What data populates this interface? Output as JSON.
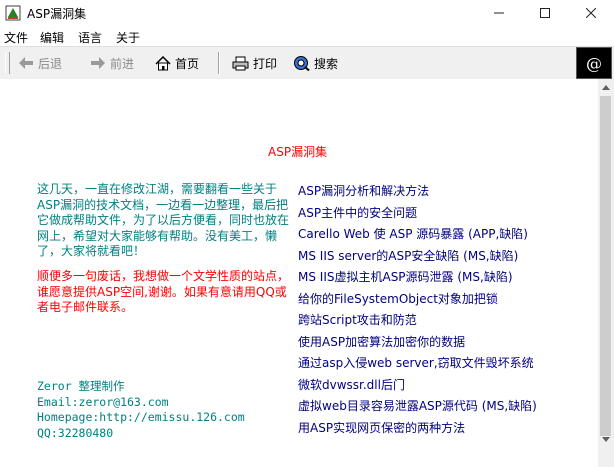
{
  "window": {
    "title": "ASP漏洞集"
  },
  "menu": {
    "items": [
      "文件",
      "编辑",
      "语言",
      "关于"
    ]
  },
  "toolbar": {
    "back_label": "后退",
    "forward_label": "前进",
    "home_label": "首页",
    "print_label": "打印",
    "search_label": "搜索",
    "logo_text": "@"
  },
  "content": {
    "title": "ASP漏洞集",
    "intro": "这几天，一直在修改江湖，需要翻看一些关于ASP漏洞的技术文档，一边看一边整理，最后把它做成帮助文件，为了以后方便看，同时也放在网上，希望对大家能够有帮助。没有美工，懒了，大家将就看吧！",
    "request": "顺便多一句废话，我想做一个文学性质的站点，谁愿意提供ASP空间,谢谢。如果有意请用QQ或者电子邮件联系。",
    "credits": {
      "maker": "Zeror 整理制作",
      "email": "Email:zeror@163.com",
      "homepage": "Homepage:http://emissu.126.com",
      "qq": "QQ:32280480"
    },
    "links": [
      "ASP漏洞分析和解决方法",
      "ASP主件中的安全问题",
      "Carello Web 使 ASP 源码暴露 (APP,缺陷)",
      "MS IIS server的ASP安全缺陷 (MS,缺陷)",
      "MS IIS虚拟主机ASP源码泄露 (MS,缺陷)",
      "给你的FileSystemObject对象加把锁",
      "跨站Script攻击和防范",
      "使用ASP加密算法加密你的数据",
      "通过asp入侵web server,窃取文件毁坏系统",
      "微软dvwssr.dll后门",
      "虚拟web目录容易泄露ASP源代码 (MS,缺陷)",
      "用ASP实现网页保密的两种方法"
    ]
  }
}
